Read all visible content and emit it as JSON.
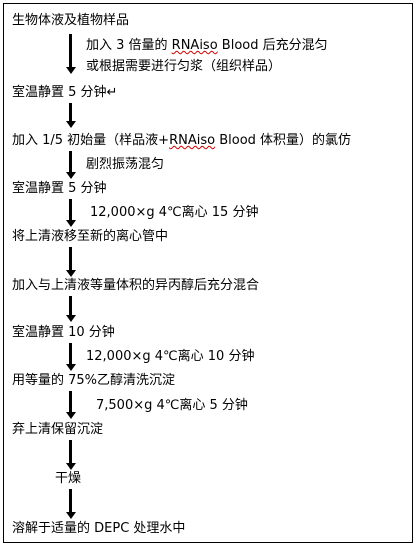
{
  "steps": [
    {
      "text": "生物体液及植物样品"
    },
    {
      "notes": [
        "加入 3 倍量的 RNAiso Blood 后充分混匀",
        "或根据需要进行匀浆（组织样品）"
      ]
    },
    {
      "text": "室温静置 5 分钟↵"
    },
    {
      "text": "加入 1/5 初始量（样品液+RNAiso Blood 体积量）的氯仿",
      "notes": [
        "剧烈振荡混匀"
      ]
    },
    {
      "text": "室温静置 5 分钟"
    },
    {
      "notes": [
        "12,000×g 4℃离心 15 分钟"
      ]
    },
    {
      "text": "将上清液移至新的离心管中"
    },
    {
      "text": "加入与上清液等量体积的异丙醇后充分混合"
    },
    {
      "text": "室温静置 10 分钟"
    },
    {
      "notes": [
        "12,000×g 4℃离心 10 分钟"
      ]
    },
    {
      "text": "用等量的 75%乙醇清洗沉淀"
    },
    {
      "notes": [
        "7,500×g 4℃离心 5 分钟"
      ]
    },
    {
      "text": "弃上清保留沉淀"
    },
    {
      "text": "干燥"
    },
    {
      "text": "溶解于适量的 DEPC 处理水中"
    }
  ]
}
